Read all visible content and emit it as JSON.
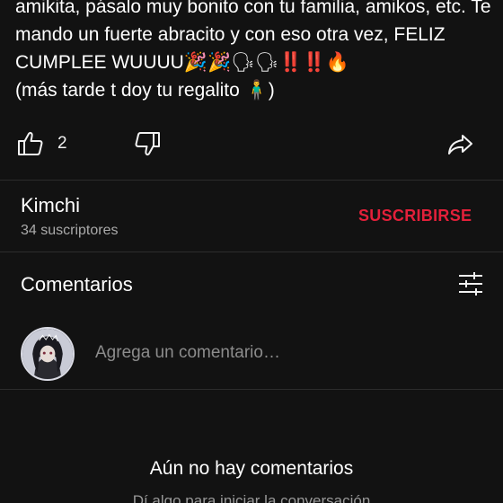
{
  "post": {
    "text": "amikita, pásalo muy bonito con tu familia, amikos, etc. Te mando un fuerte abracito y con eso otra vez, FELIZ CUMPLEE WUUUU🎉🎉🗣🗣‼️‼️🔥\n(más tarde t doy tu regalito 🧍‍♂️)"
  },
  "actions": {
    "like_icon": "thumbs-up-icon",
    "like_count": "2",
    "dislike_icon": "thumbs-down-icon",
    "share_icon": "share-icon"
  },
  "channel": {
    "name": "Kimchi",
    "subscribers": "34 suscriptores",
    "subscribe_label": "SUSCRIBIRSE",
    "subscribe_color": "#e3203a"
  },
  "comments": {
    "title": "Comentarios",
    "filter_icon": "filter-sliders-icon",
    "input_placeholder": "Agrega un comentario…",
    "empty_title": "Aún no hay comentarios",
    "empty_subtitle": "Dí algo para iniciar la conversación"
  }
}
